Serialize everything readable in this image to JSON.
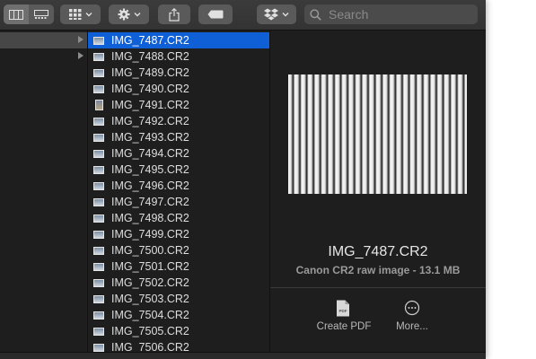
{
  "search": {
    "placeholder": "Search"
  },
  "files": [
    "IMG_7487.CR2",
    "IMG_7488.CR2",
    "IMG_7489.CR2",
    "IMG_7490.CR2",
    "IMG_7491.CR2",
    "IMG_7492.CR2",
    "IMG_7493.CR2",
    "IMG_7494.CR2",
    "IMG_7495.CR2",
    "IMG_7496.CR2",
    "IMG_7497.CR2",
    "IMG_7498.CR2",
    "IMG_7499.CR2",
    "IMG_7500.CR2",
    "IMG_7501.CR2",
    "IMG_7502.CR2",
    "IMG_7503.CR2",
    "IMG_7504.CR2",
    "IMG_7505.CR2",
    "IMG_7506.CR2"
  ],
  "preview": {
    "name": "IMG_7487.CR2",
    "kind": "Canon CR2 raw image - 13.1 MB"
  },
  "actions": {
    "pdf_icon_text": "PDF",
    "create_pdf": "Create PDF",
    "more": "More..."
  },
  "colors": {
    "selection": "#0f5fd6",
    "background": "#1e1e1e"
  }
}
